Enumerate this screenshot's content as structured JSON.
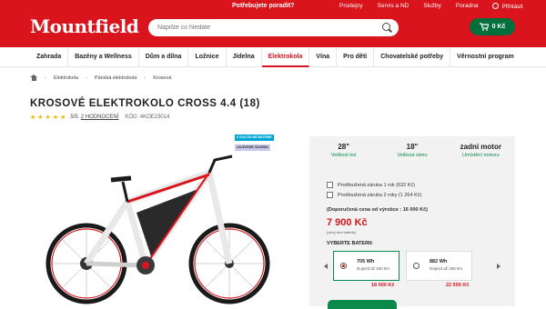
{
  "header": {
    "logo": "Mountfield",
    "help": "Potřebujete poradit?",
    "links": [
      "Prodejny",
      "Servis a ND",
      "Služby",
      "Poradna"
    ],
    "login": "Přihlásit",
    "search_placeholder": "Napište co hledáte",
    "cart": "0 Kč"
  },
  "nav": [
    "Zahrada",
    "Bazény a Wellness",
    "Dům a dílna",
    "Ložnice",
    "Jídelna",
    "Elektrokola",
    "Vína",
    "Pro děti",
    "Chovatelské potřeby",
    "Věrnostní program"
  ],
  "breadcrumb": [
    "Elektrokola",
    "Pánská elektrokola",
    "Krosová"
  ],
  "product": {
    "title": "KROSOVÉ ELEKTROKOLO CROSS 4.4 (18)",
    "stars": "★★★★★",
    "rating": "5/5",
    "reviews": "2 HODNOCENÍ",
    "code": "KÓD: 4KOE23014",
    "badges": [
      "3 VOLITELNÉ BATERIE",
      "ZAVEZEME ZDARMA"
    ]
  },
  "params": [
    {
      "value": "28\"",
      "label": "Velikost kol"
    },
    {
      "value": "18\"",
      "label": "Velikost rámu"
    },
    {
      "value": "zadní motor",
      "label": "Umístění motoru"
    }
  ],
  "warranty": [
    "Prodloužená záruka 1 rok (632 Kč)",
    "Prodloužená záruka 2 roky (1 264 Kč)"
  ],
  "price": {
    "recommended": "(Doporučená cena od výrobce : 16 000 Kč)",
    "current": "7 900 Kč",
    "vat": "(ceny bez baterie)"
  },
  "battery": {
    "label": "VYBERTE BATERII:",
    "options": [
      {
        "wh": "705 Wh",
        "range": "Dojezd až 160 km",
        "price": "18 000 Kč",
        "selected": true
      },
      {
        "wh": "882 Wh",
        "range": "Dojezd až 200 km",
        "price": "22 500 Kč",
        "selected": false
      }
    ]
  },
  "colors": {
    "brand_red": "#d9141c",
    "green": "#0b8a4c"
  }
}
